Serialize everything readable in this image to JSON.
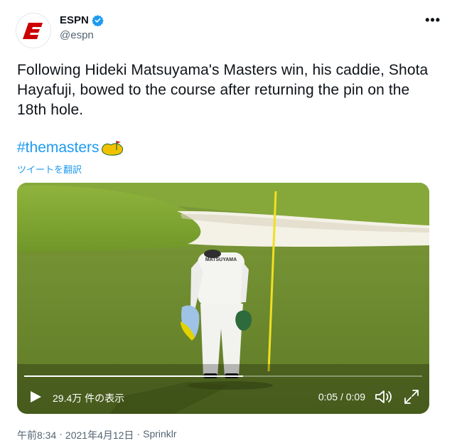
{
  "author": {
    "display_name": "ESPN",
    "handle": "@espn",
    "verified": true,
    "avatar_icon": "espn-logo-icon",
    "brand_color": "#cc0000"
  },
  "tweet": {
    "text": "Following Hideki Matsuyama's Masters win, his caddie, Shota Hayafuji, bowed to the course after returning the pin on the 18th hole.",
    "hashtag": "#themasters",
    "hashtag_icon": "masters-logo-icon",
    "translate_label": "ツイートを翻訳"
  },
  "video": {
    "view_count": "29.4万 件の表示",
    "current_time": "0:05",
    "duration": "0:09",
    "time_display": "0:05 / 0:09",
    "progress": 0.55,
    "shirt_text": "MATSUYAMA",
    "icons": [
      "play-icon",
      "volume-icon",
      "fullscreen-icon"
    ]
  },
  "meta": {
    "time": "午前8:34",
    "separator": "·",
    "date": "2021年4月12日",
    "source": "Sprinklr"
  },
  "colors": {
    "link": "#1d9bf0",
    "secondary_text": "#536471",
    "text": "#0f1419"
  }
}
